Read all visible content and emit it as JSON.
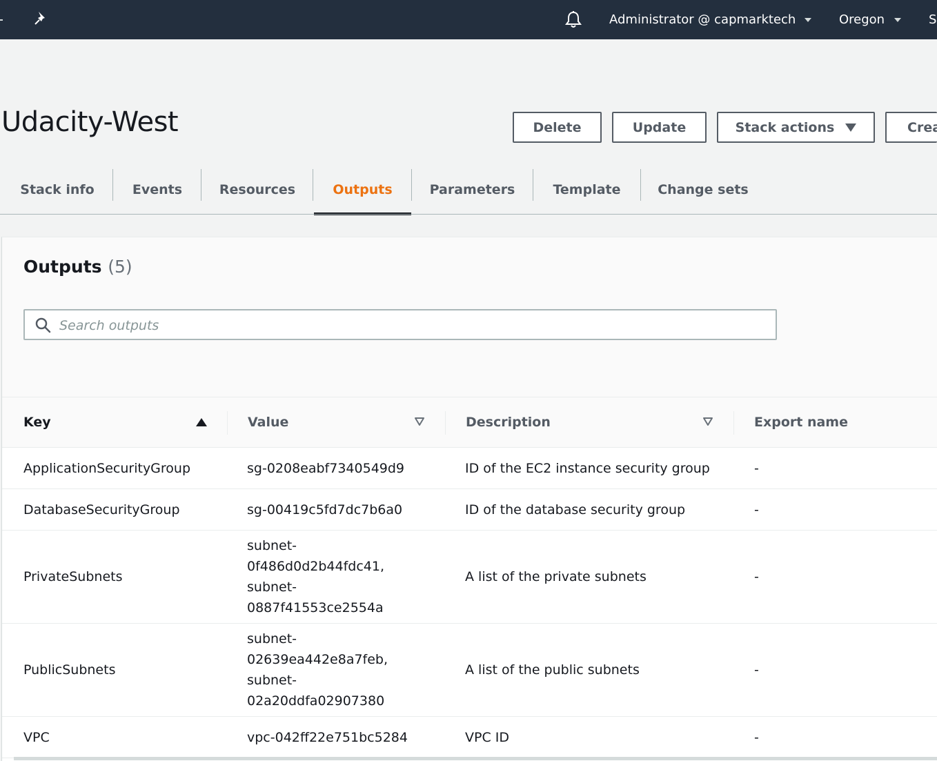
{
  "topbar": {
    "user_label": "Administrator @ capmarktech",
    "region_label": "Oregon",
    "support_label": "S"
  },
  "header": {
    "title": "Udacity-West",
    "buttons": {
      "delete": "Delete",
      "update": "Update",
      "stack_actions": "Stack actions",
      "create": "Crea"
    }
  },
  "tabs": [
    {
      "label": "Stack info"
    },
    {
      "label": "Events"
    },
    {
      "label": "Resources"
    },
    {
      "label": "Outputs",
      "active": true
    },
    {
      "label": "Parameters"
    },
    {
      "label": "Template"
    },
    {
      "label": "Change sets"
    }
  ],
  "outputs": {
    "title": "Outputs",
    "count": "(5)",
    "search_placeholder": "Search outputs",
    "columns": {
      "key": "Key",
      "value": "Value",
      "description": "Description",
      "export_name": "Export name"
    },
    "rows": [
      {
        "key": "ApplicationSecurityGroup",
        "value": "sg-0208eabf7340549d9",
        "description": "ID of the EC2 instance security group",
        "export_name": "-"
      },
      {
        "key": "DatabaseSecurityGroup",
        "value": "sg-00419c5fd7dc7b6a0",
        "description": "ID of the database security group",
        "export_name": "-"
      },
      {
        "key": "PrivateSubnets",
        "value": "subnet-\n0f486d0d2b44fdc41,\nsubnet-\n0887f41553ce2554a",
        "description": "A list of the private subnets",
        "export_name": "-"
      },
      {
        "key": "PublicSubnets",
        "value": "subnet-\n02639ea442e8a7feb,\nsubnet-\n02a20ddfa02907380",
        "description": "A list of the public subnets",
        "export_name": "-"
      },
      {
        "key": "VPC",
        "value": "vpc-042ff22e751bc5284",
        "description": "VPC ID",
        "export_name": "-"
      }
    ]
  },
  "colors": {
    "nav_bg": "#232f3e",
    "accent_orange": "#ec7211",
    "page_bg": "#f2f3f3"
  }
}
